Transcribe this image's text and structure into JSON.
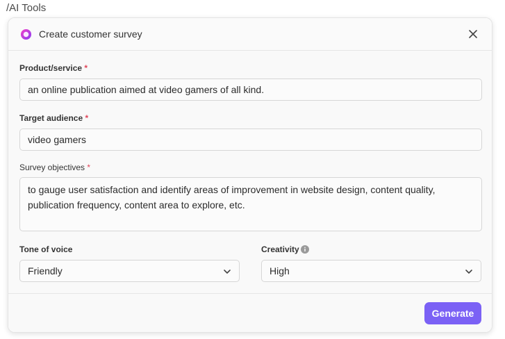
{
  "breadcrumb": "/AI Tools",
  "modal": {
    "title": "Create customer survey",
    "ai_icon": "ai-sparkle-icon",
    "close_icon": "close-icon"
  },
  "fields": {
    "product": {
      "label": "Product/service",
      "required_mark": "*",
      "value": "an online publication aimed at video gamers of all kind."
    },
    "audience": {
      "label": "Target audience",
      "required_mark": "*",
      "value": "video gamers"
    },
    "objectives": {
      "label": "Survey objectives",
      "required_mark": "*",
      "value": "to gauge user satisfaction and identify areas of improvement in website design, content quality, publication frequency, content area to explore, etc."
    },
    "tone": {
      "label": "Tone of voice",
      "value": "Friendly"
    },
    "creativity": {
      "label": "Creativity",
      "value": "High"
    }
  },
  "footer": {
    "generate_label": "Generate"
  },
  "colors": {
    "accent": "#7b61f5",
    "required": "#e0455a"
  }
}
